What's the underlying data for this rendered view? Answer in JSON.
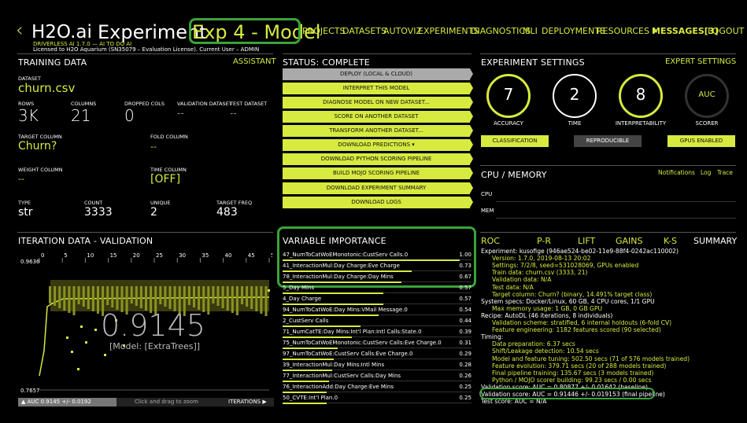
{
  "header": {
    "back_glyph": "‹",
    "brand": "H2O.ai",
    "title": "Experiment",
    "experiment_name": "Exp 4 - Model",
    "sub_line1": "DRIVERLESS AI 1.7.0 — AI TO DO AI",
    "sub_line2": "Licensed to H2O Aquarium (SN35079 – Evaluation License). Current User – ADMIN",
    "nav": [
      "PROJECTS",
      "DATASETS",
      "AUTOVIZ",
      "EXPERIMENTS",
      "DIAGNOSTICS",
      "MLI",
      "DEPLOYMENTS",
      "RESOURCES ▾",
      "MESSAGES[3]",
      "LOGOUT"
    ]
  },
  "training": {
    "title": "TRAINING DATA",
    "assistant": "ASSISTANT",
    "dataset_label": "DATASET",
    "dataset": "churn.csv",
    "rows_label": "ROWS",
    "rows": "3K",
    "columns_label": "COLUMNS",
    "columns": "21",
    "dropped_label": "DROPPED COLS",
    "dropped": "0",
    "validation_label": "VALIDATION DATASET",
    "validation": "--",
    "test_label": "TEST DATASET",
    "test": "--",
    "target_label": "TARGET COLUMN",
    "target": "Churn?",
    "fold_label": "FOLD COLUMN",
    "fold": "--",
    "weight_label": "WEIGHT COLUMN",
    "weight": "--",
    "time_label": "TIME COLUMN",
    "time": "[OFF]",
    "type_label": "TYPE",
    "type": "str",
    "count_label": "COUNT",
    "count": "3333",
    "unique_label": "UNIQUE",
    "unique": "2",
    "freq_label": "TARGET FREQ",
    "freq": "483"
  },
  "status": {
    "title": "STATUS: COMPLETE",
    "buttons": [
      "DEPLOY (LOCAL & CLOUD)",
      "INTERPRET THIS MODEL",
      "DIAGNOSE MODEL ON NEW DATASET...",
      "SCORE ON ANOTHER DATASET",
      "TRANSFORM ANOTHER DATASET...",
      "DOWNLOAD PREDICTIONS ▾",
      "DOWNLOAD PYTHON SCORING PIPELINE",
      "BUILD MOJO SCORING PIPELINE",
      "DOWNLOAD EXPERIMENT SUMMARY",
      "DOWNLOAD LOGS"
    ]
  },
  "settings": {
    "title": "EXPERIMENT SETTINGS",
    "expert": "EXPERT SETTINGS",
    "accuracy": "7",
    "accuracy_label": "ACCURACY",
    "time": "2",
    "time_label": "TIME",
    "interpretability": "8",
    "interpretability_label": "INTERPRETABILITY",
    "scorer": "AUC",
    "scorer_label": "SCORER",
    "tag_classification": "CLASSIFICATION",
    "tag_reproducible": "REPRODUCIBLE",
    "tag_gpus": "GPUS ENABLED"
  },
  "cpu": {
    "title": "CPU / MEMORY",
    "notifications": "Notifications",
    "log": "Log",
    "trace": "Trace",
    "cpu_label": "CPU",
    "mem_label": "MEM"
  },
  "iteration": {
    "title": "ITERATION DATA - VALIDATION",
    "ticks": [
      "0",
      "5",
      "10",
      "15",
      "20",
      "25",
      "30",
      "35",
      "40",
      "45",
      "50"
    ],
    "ymax": "0.9636",
    "ymin": "0.7657",
    "score": "0.9145",
    "model": "[Model: [ExtraTrees]]",
    "footer_auc": "▲ AUC 0.9145 +/- 0.0192",
    "footer_hint": "Click and drag to zoom",
    "footer_iter": "ITERATIONS ▶"
  },
  "variables": {
    "title": "VARIABLE IMPORTANCE",
    "rows": [
      {
        "name": "47_NumToCatWoEMonotonic:CustServ Calls.0",
        "value": "1.00",
        "frac": 1.0
      },
      {
        "name": "41_InteractionMul:Day Charge:Eve Charge",
        "value": "0.73",
        "frac": 0.73
      },
      {
        "name": "78_InteractionMul:Day Charge:Day Mins",
        "value": "0.67",
        "frac": 0.67
      },
      {
        "name": "5_Day Mins",
        "value": "0.57",
        "frac": 0.57
      },
      {
        "name": "4_Day Charge",
        "value": "0.57",
        "frac": 0.57
      },
      {
        "name": "94_NumToCatWoE:Day Mins:VMail Message.0",
        "value": "0.54",
        "frac": 0.54
      },
      {
        "name": "2_CustServ Calls",
        "value": "0.44",
        "frac": 0.44
      },
      {
        "name": "71_NumCatTE:Day Mins:Int'l Plan:Intl Calls:State.0",
        "value": "0.39",
        "frac": 0.39
      },
      {
        "name": "75_NumToCatWoEMonotonic:CustServ Calls:Eve Charge.0",
        "value": "0.31",
        "frac": 0.31
      },
      {
        "name": "97_NumToCatWoE:CustServ Calls:Eve Charge.0",
        "value": "0.29",
        "frac": 0.29
      },
      {
        "name": "39_InteractionMul:Day Mins:Intl Mins",
        "value": "0.28",
        "frac": 0.28
      },
      {
        "name": "77_InteractionMul:CustServ Calls:Day Mins",
        "value": "0.26",
        "frac": 0.26
      },
      {
        "name": "76_InteractionAdd:Day Charge:Eve Mins",
        "value": "0.25",
        "frac": 0.25
      },
      {
        "name": "50_CVTE:Int'l Plan.0",
        "value": "0.25",
        "frac": 0.25
      }
    ]
  },
  "summary": {
    "tabs": [
      "ROC",
      "P-R",
      "LIFT",
      "GAINS",
      "K-S",
      "SUMMARY"
    ],
    "lines": [
      "Experiment: kusofige (946ae524-be02-11e9-88f4-0242ac110002)",
      "    Version: 1.7.0, 2019-08-13 20:02",
      "    Settings: 7/2/8, seed=531028069, GPUs enabled",
      "    Train data: churn.csv (3333, 21)",
      "    Validation data: N/A",
      "    Test data: N/A",
      "    Target column: Churn? (binary, 14.491% target class)",
      "System specs: Docker/Linux, 60 GB, 4 CPU cores, 1/1 GPU",
      "    Max memory usage: 1 GB, 0 GB GPU",
      "Recipe: AutoDL (46 iterations, 8 individuals)",
      "    Validation scheme: stratified, 6 internal holdouts (6-fold CV)",
      "    Feature engineering: 1182 features scored (90 selected)",
      "Timing:",
      "    Data preparation: 6.37 secs",
      "    Shift/Leakage detection: 10.54 secs",
      "    Model and feature tuning: 502.50 secs (71 of 576 models trained)",
      "    Feature evolution: 379.71 secs (20 of 288 models trained)",
      "    Final pipeline training: 135.67 secs (3 models trained)",
      "    Python / MOJO scorer building: 99.23 secs / 0.00 secs",
      "Validation score: AUC = 0.80877 +/- 0.01642 (baseline)",
      "Validation score: AUC = 0.91446 +/- 0.019153 (final pipeline)",
      "Test score:         AUC = N/A"
    ]
  }
}
